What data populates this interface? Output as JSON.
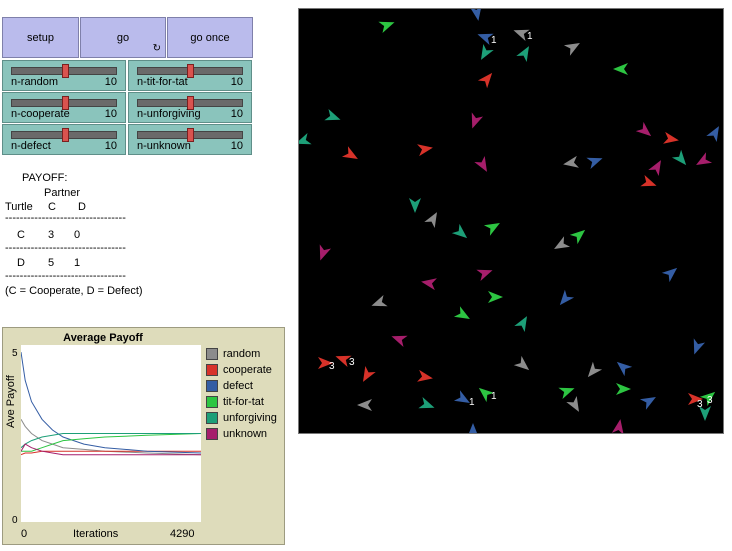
{
  "buttons": [
    {
      "label": "setup"
    },
    {
      "label": "go"
    },
    {
      "label": "go once"
    }
  ],
  "sliders": [
    {
      "name": "n-random",
      "value": "10",
      "level": 0.5
    },
    {
      "name": "n-tit-for-tat",
      "value": "10",
      "level": 0.5
    },
    {
      "name": "n-cooperate",
      "value": "10",
      "level": 0.5
    },
    {
      "name": "n-unforgiving",
      "value": "10",
      "level": 0.5
    },
    {
      "name": "n-defect",
      "value": "10",
      "level": 0.5
    },
    {
      "name": "n-unknown",
      "value": "10",
      "level": 0.5
    }
  ],
  "payoff": {
    "title": "PAYOFF:",
    "partner": "Partner",
    "turtle": "Turtle",
    "col_c": "C",
    "col_d": "D",
    "dash": "---------------------------------",
    "row1": [
      "C",
      "3",
      "0"
    ],
    "row2": [
      "D",
      "5",
      "1"
    ],
    "note": "(C = Cooperate, D = Defect)"
  },
  "plot": {
    "title": "Average Payoff",
    "ylabel": "Ave Payoff",
    "xlabel": "Iterations",
    "xmin": "0",
    "xmax": "4290",
    "ymin": "0",
    "ymax": "5"
  },
  "legend": [
    {
      "name": "random",
      "color": "#8c8c8c"
    },
    {
      "name": "cooperate",
      "color": "#d73229"
    },
    {
      "name": "defect",
      "color": "#345da4"
    },
    {
      "name": "tit-for-tat",
      "color": "#2dc542"
    },
    {
      "name": "unforgiving",
      "color": "#1d9f78"
    },
    {
      "name": "unknown",
      "color": "#a61e6b"
    }
  ],
  "chart_data": {
    "type": "line",
    "title": "Average Payoff",
    "xlabel": "Iterations",
    "ylabel": "Ave Payoff",
    "xlim": [
      0,
      4290
    ],
    "ylim": [
      0,
      5
    ],
    "x": [
      0,
      100,
      250,
      500,
      750,
      1000,
      1500,
      2000,
      3000,
      4290
    ],
    "series": [
      {
        "name": "random",
        "values": [
          2.9,
          2.7,
          2.5,
          2.3,
          2.2,
          2.1,
          2.05,
          2.0,
          1.95,
          1.9
        ]
      },
      {
        "name": "cooperate",
        "values": [
          1.9,
          1.95,
          1.95,
          2.0,
          2.0,
          2.0,
          2.0,
          2.0,
          2.0,
          2.0
        ]
      },
      {
        "name": "defect",
        "values": [
          4.8,
          4.0,
          3.4,
          2.9,
          2.6,
          2.4,
          2.2,
          2.1,
          2.0,
          1.95
        ]
      },
      {
        "name": "tit-for-tat",
        "values": [
          2.0,
          2.0,
          2.0,
          2.1,
          2.2,
          2.3,
          2.35,
          2.4,
          2.45,
          2.5
        ]
      },
      {
        "name": "unforgiving",
        "values": [
          2.1,
          2.2,
          2.3,
          2.4,
          2.45,
          2.5,
          2.5,
          2.5,
          2.5,
          2.5
        ]
      },
      {
        "name": "unknown",
        "values": [
          2.0,
          2.2,
          2.1,
          2.0,
          1.95,
          1.9,
          1.9,
          1.9,
          1.9,
          1.9
        ]
      }
    ]
  },
  "world": {
    "background": "#000000",
    "colors": {
      "random": "#8c8c8c",
      "cooperate": "#d73229",
      "defect": "#345da4",
      "tit-for-tat": "#2dc542",
      "unforgiving": "#1d9f78",
      "unknown": "#a61e6b"
    },
    "labels": [
      "1",
      "1",
      "3",
      "3",
      "1",
      "1",
      "3",
      "3"
    ]
  }
}
